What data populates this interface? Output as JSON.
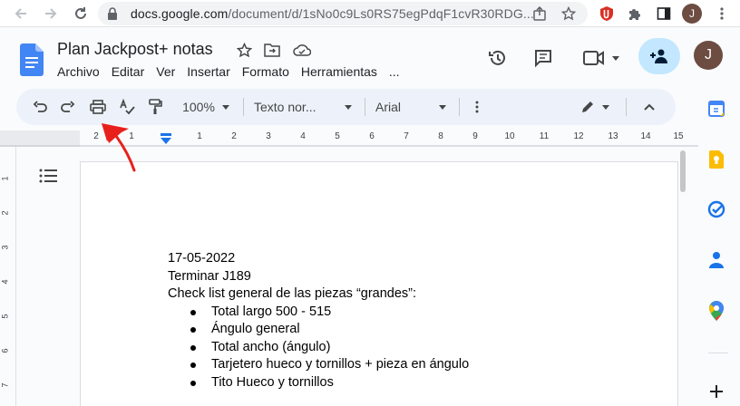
{
  "browser": {
    "url_host": "docs.google.com",
    "url_path": "/document/d/1sNo0c9Ls0RS75egPdqF1cvR30RDG...",
    "profile_initial": "J",
    "icons": [
      "back-arrow-icon",
      "forward-arrow-icon",
      "reload-icon",
      "lock-icon",
      "share-icon",
      "star-icon",
      "extension-icon",
      "puzzle-icon",
      "sidebar-icon",
      "kebab-menu-icon"
    ]
  },
  "docs": {
    "title": "Plan Jackpost+ notas",
    "menu": [
      "Archivo",
      "Editar",
      "Ver",
      "Insertar",
      "Formato",
      "Herramientas",
      "..."
    ],
    "account_initial": "J"
  },
  "toolbar": {
    "zoom": "100%",
    "style": "Texto nor...",
    "font": "Arial"
  },
  "ruler": {
    "numbers": [
      "2",
      "1",
      "1",
      "2",
      "3",
      "4",
      "5",
      "6",
      "7",
      "8",
      "9",
      "10",
      "11",
      "12",
      "13",
      "14",
      "15"
    ]
  },
  "vruler": {
    "numbers": [
      "1",
      "2",
      "3",
      "4",
      "5",
      "6",
      "7"
    ]
  },
  "document": {
    "lines": [
      "17-05-2022",
      "Terminar J189",
      "Check list general de las piezas “grandes”:"
    ],
    "bullets": [
      "Total  largo 500 - 515",
      "Ángulo general",
      "Total ancho (ángulo)",
      "Tarjetero hueco y tornillos + pieza en ángulo",
      "Tito Hueco y tornillos"
    ]
  },
  "colors": {
    "accent": "#1a73e8",
    "share_bg": "#c2e7ff",
    "toolbar_bg": "#edf2fa",
    "annotation_arrow": "#e8201c"
  }
}
